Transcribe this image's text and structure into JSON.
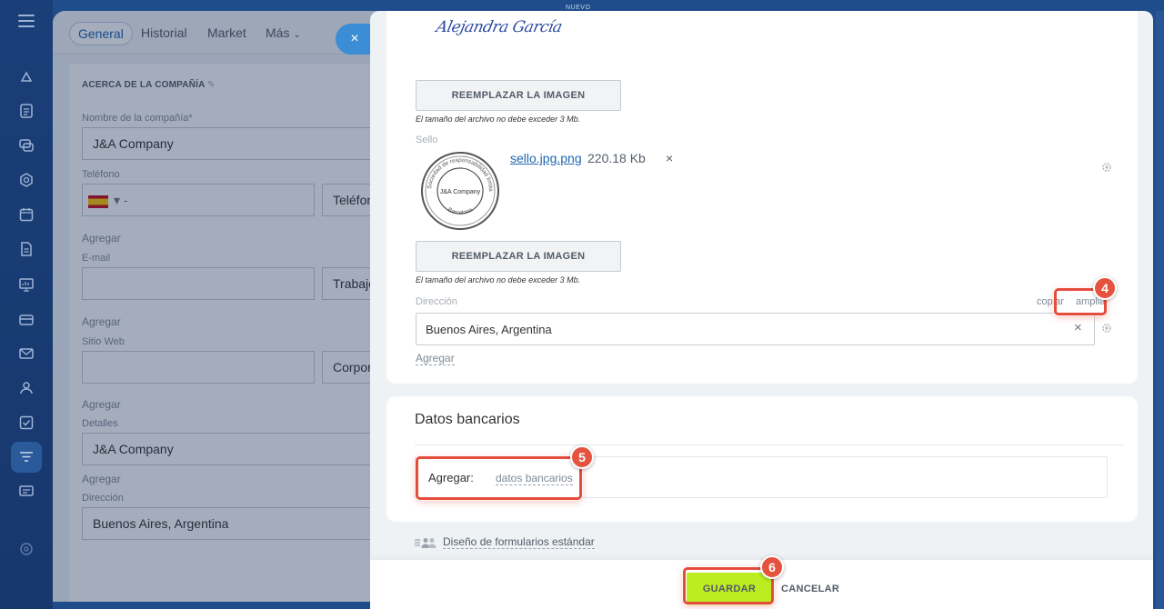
{
  "rail": {
    "icons": [
      "menu-icon",
      "crm-icon",
      "tasks-icon",
      "chat-icon",
      "sites-icon",
      "calendar-icon",
      "docs-icon",
      "report-icon",
      "payments-icon",
      "mail-icon",
      "contacts-icon",
      "check-icon",
      "funnel-icon",
      "screen-icon",
      "settings-icon"
    ]
  },
  "background": {
    "tabs": [
      "General",
      "Historial",
      "Market",
      "Más"
    ],
    "section_title": "ACERCA DE LA COMPAÑÍA",
    "company_label": "Nombre de la compañía*",
    "company_value": "J&A Company",
    "phone_label": "Teléfono",
    "phone_prefix": "▾ -",
    "phone_type": "Teléfono",
    "add_label": "Agregar",
    "email_label": "E-mail",
    "email_type": "Trabajo",
    "web_label": "Sitio Web",
    "web_type": "Corpor",
    "details_label": "Detalles",
    "details_value": "J&A Company",
    "address_label": "Dirección",
    "address_value": "Buenos Aires, Argentina",
    "nuevo": "NUEVO"
  },
  "panel": {
    "signature_text": "Alejandra García",
    "replace_button_label": "REEMPLAZAR LA IMAGEN",
    "size_hint": "El tamaño del archivo no debe exceder 3 Mb.",
    "seal_label": "Sello",
    "seal_company": "J&A Company",
    "seal_ring_text": "Sociedad de responsabilidad limitada",
    "seal_city": "Barcelona",
    "file_name": "sello.jpg.png",
    "file_size": "220.18 Kb",
    "file_remove": "×",
    "address_label": "Dirección",
    "copy_label": "copiar",
    "expand_label": "ampliar",
    "address_value": "Buenos Aires, Argentina",
    "address_clear": "×",
    "add_link": "Agregar",
    "bank_title": "Datos bancarios",
    "bank_add_label": "Agregar:",
    "bank_add_link": "datos bancarios",
    "form_design_link": "Diseño de formularios estándar",
    "save_label": "GUARDAR",
    "cancel_label": "CANCELAR"
  },
  "overlays": {
    "step4": "4",
    "step5": "5",
    "step6": "6",
    "color": "#e54c3c"
  },
  "close_symbol": "×"
}
